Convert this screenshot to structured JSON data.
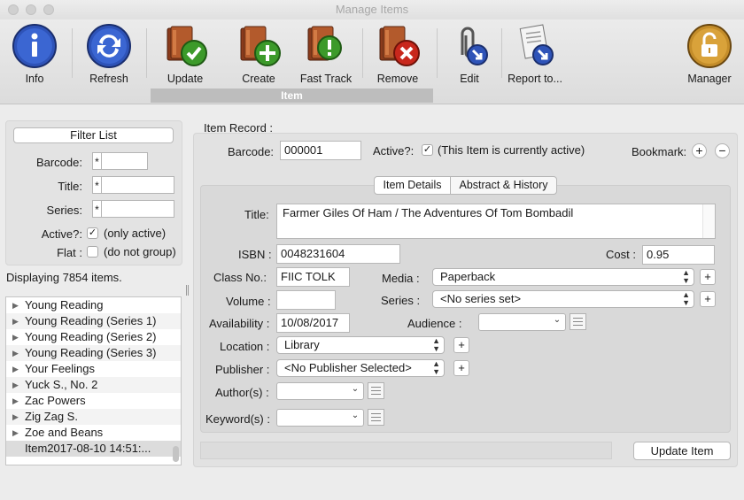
{
  "window": {
    "title": "Manage Items"
  },
  "toolbar": {
    "buttons": [
      {
        "label": "Info",
        "icon": "info-icon"
      },
      {
        "label": "Refresh",
        "icon": "refresh-icon"
      },
      {
        "label": "Update",
        "icon": "book-check-icon"
      },
      {
        "label": "Create",
        "icon": "book-plus-icon"
      },
      {
        "label": "Fast Track",
        "icon": "book-exclamation-icon"
      },
      {
        "label": "Remove",
        "icon": "book-remove-icon"
      },
      {
        "label": "Edit",
        "icon": "paperclip-edit-icon"
      },
      {
        "label": "Report to...",
        "icon": "report-icon"
      },
      {
        "label": "Manager",
        "icon": "lock-icon"
      }
    ],
    "group_label": "Item"
  },
  "filter": {
    "button_label": "Filter List",
    "barcode_label": "Barcode:",
    "title_label": "Title:",
    "series_label": "Series:",
    "active_label": "Active?:",
    "active_text": "(only active)",
    "active_checked": true,
    "flat_label": "Flat :",
    "flat_text": "(do not group)",
    "flat_checked": false,
    "wildcard": "*"
  },
  "list": {
    "count_text": "Displaying 7854 items.",
    "items": [
      "Young Reading",
      "Young Reading (Series 1)",
      "Young Reading (Series 2)",
      "Young Reading (Series 3)",
      "Your Feelings",
      "Yuck S., No. 2",
      "Zac Powers",
      "Zig Zag S.",
      "Zoe and Beans",
      "Item2017-08-10 14:51:..."
    ]
  },
  "record": {
    "section_label": "Item Record :",
    "barcode_label": "Barcode:",
    "barcode_value": "000001",
    "active_label": "Active?:",
    "active_checked": true,
    "active_text": "(This Item is currently active)",
    "bookmark_label": "Bookmark:",
    "tabs": [
      "Item Details",
      "Abstract & History"
    ],
    "title_label": "Title:",
    "title_value": "Farmer Giles Of Ham / The Adventures Of Tom Bombadil",
    "isbn_label": "ISBN :",
    "isbn_value": "0048231604",
    "cost_label": "Cost :",
    "cost_value": "0.95",
    "class_label": "Class No.:",
    "class_value": "FIIC TOLK",
    "media_label": "Media :",
    "media_value": "Paperback",
    "volume_label": "Volume :",
    "volume_value": "",
    "series_label": "Series :",
    "series_value": "<No series set>",
    "availability_label": "Availability :",
    "availability_value": "10/08/2017",
    "audience_label": "Audience :",
    "audience_value": "",
    "location_label": "Location :",
    "location_value": "Library",
    "publisher_label": "Publisher :",
    "publisher_value": "<No Publisher Selected>",
    "authors_label": "Author(s) :",
    "keywords_label": "Keyword(s) :",
    "update_button": "Update Item"
  }
}
